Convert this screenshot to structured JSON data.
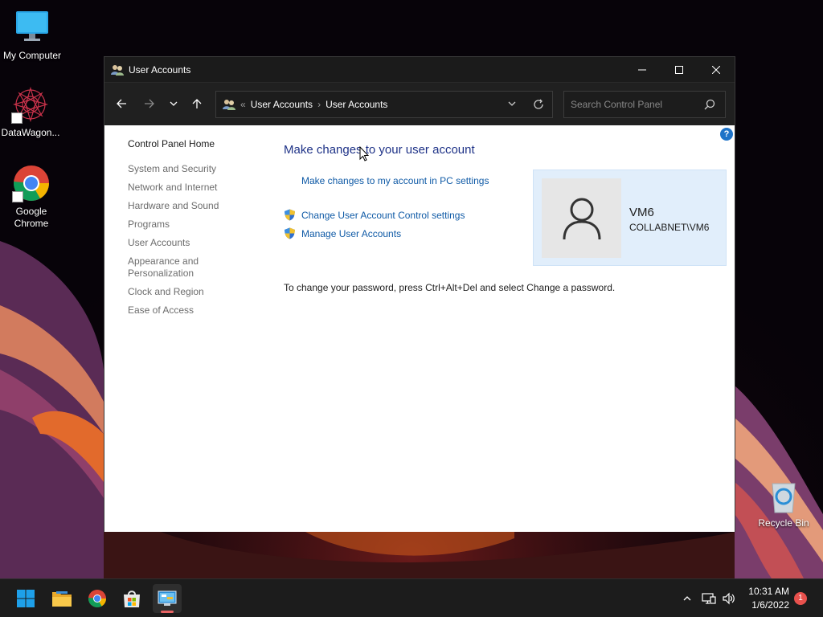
{
  "desktop": {
    "icons": [
      {
        "label": "My Computer"
      },
      {
        "label": "DataWagon..."
      },
      {
        "label": "Google Chrome"
      },
      {
        "label": "Recycle Bin"
      }
    ]
  },
  "window": {
    "title": "User Accounts",
    "breadcrumb": {
      "overflow": "«",
      "items": [
        "User Accounts",
        "User Accounts"
      ],
      "separator": "›"
    },
    "search_placeholder": "Search Control Panel",
    "help_label": "?"
  },
  "sidebar": {
    "home": "Control Panel Home",
    "items": [
      "System and Security",
      "Network and Internet",
      "Hardware and Sound",
      "Programs",
      "User Accounts",
      "Appearance and Personalization",
      "Clock and Region",
      "Ease of Access"
    ]
  },
  "main": {
    "title": "Make changes to your user account",
    "links": {
      "pc_settings": "Make changes to my account in PC settings",
      "uac": "Change User Account Control settings",
      "manage": "Manage User Accounts"
    },
    "password_note": "To change your password, press Ctrl+Alt+Del and select Change a password."
  },
  "user": {
    "name": "VM6",
    "domain": "COLLABNET\\VM6"
  },
  "taskbar": {
    "time": "10:31 AM",
    "date": "1/6/2022",
    "notification_count": "1"
  }
}
